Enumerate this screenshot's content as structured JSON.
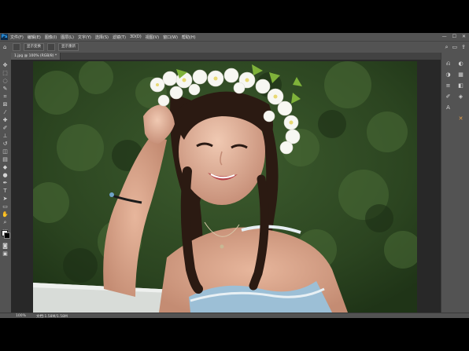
{
  "app": {
    "logo_text": "Ps",
    "menu": [
      "文件(F)",
      "编辑(E)",
      "图像(I)",
      "图层(L)",
      "文字(Y)",
      "选择(S)",
      "滤镜(T)",
      "3D(D)",
      "视图(V)",
      "窗口(W)",
      "帮助(H)"
    ],
    "window_controls": [
      "—",
      "☐",
      "✕"
    ]
  },
  "options_bar": {
    "home_icon": "home-icon",
    "buttons": [
      "显示变换",
      "显示重新"
    ],
    "right_icons": [
      "search-icon",
      "workspace-icon",
      "share-icon"
    ]
  },
  "document": {
    "tab_label": "1.jpg @ 100% (RGB/8) *"
  },
  "status": {
    "zoom": "100%",
    "doc_info": "文档:1.58M/1.58M"
  },
  "colors": {
    "ui_bg": "#535353",
    "canvas_bg": "#282828",
    "ps_blue": "#31a8ff"
  }
}
